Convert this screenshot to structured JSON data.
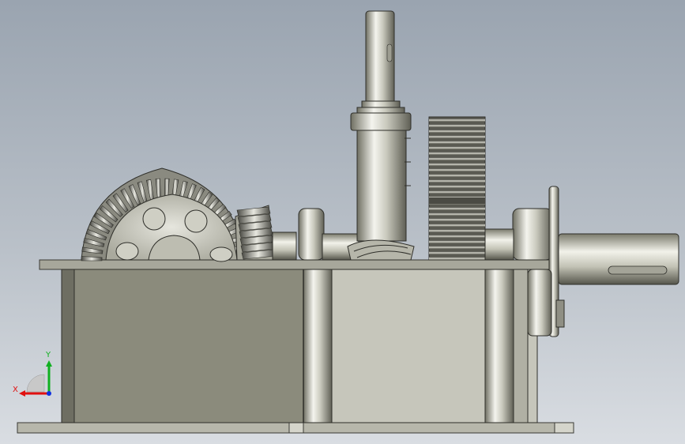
{
  "viewport": {
    "background_top": "#9aa4b0",
    "background_bottom": "#d9dde2"
  },
  "model": {
    "parts": [
      "base-plate",
      "gearbox-housing",
      "bevel-gear",
      "bevel-pinion",
      "vertical-input-shaft",
      "worm",
      "spur-gear",
      "bearing-housing-left",
      "bearing-housing-right",
      "output-shaft"
    ]
  },
  "triad": {
    "x_label": "X",
    "y_label": "Y",
    "x_color": "#e01010",
    "y_color": "#10b020",
    "z_color": "#1030e0"
  }
}
